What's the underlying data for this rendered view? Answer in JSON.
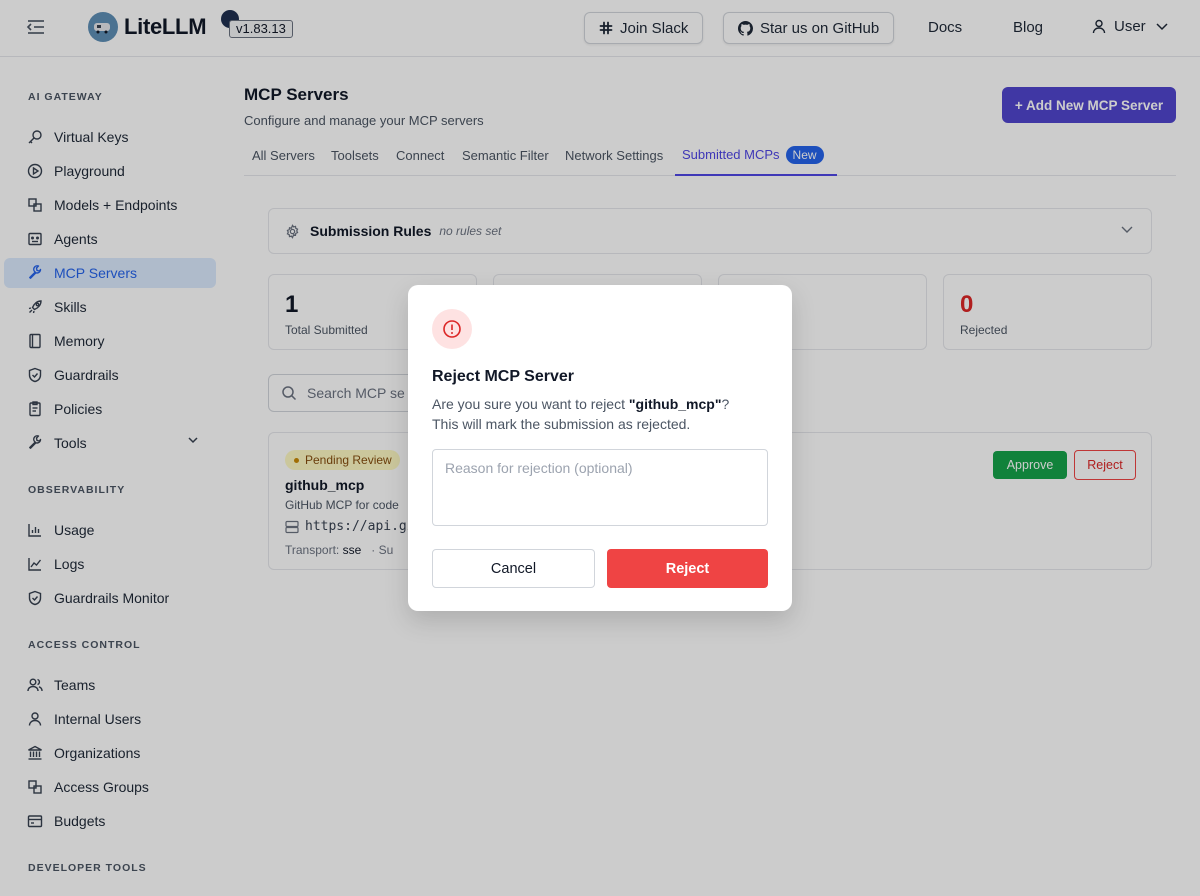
{
  "header": {
    "logo_text": "LiteLLM",
    "version": "v1.83.13",
    "join_slack": "Join Slack",
    "github": "Star us on GitHub",
    "docs": "Docs",
    "blog": "Blog",
    "user": "User"
  },
  "sidebar": {
    "sections": [
      {
        "title": "AI GATEWAY",
        "items": [
          {
            "label": "Virtual Keys",
            "icon": "key-icon"
          },
          {
            "label": "Playground",
            "icon": "play-icon"
          },
          {
            "label": "Models + Endpoints",
            "icon": "blocks-icon"
          },
          {
            "label": "Agents",
            "icon": "robot-icon"
          },
          {
            "label": "MCP Servers",
            "icon": "wrench-icon",
            "active": true
          },
          {
            "label": "Skills",
            "icon": "rocket-icon"
          },
          {
            "label": "Memory",
            "icon": "book-icon"
          },
          {
            "label": "Guardrails",
            "icon": "shield-icon"
          },
          {
            "label": "Policies",
            "icon": "clipboard-icon"
          },
          {
            "label": "Tools",
            "icon": "tool-icon"
          }
        ]
      },
      {
        "title": "OBSERVABILITY",
        "items": [
          {
            "label": "Usage",
            "icon": "bar-chart-icon"
          },
          {
            "label": "Logs",
            "icon": "line-chart-icon"
          },
          {
            "label": "Guardrails Monitor",
            "icon": "shield-icon"
          }
        ]
      },
      {
        "title": "ACCESS CONTROL",
        "items": [
          {
            "label": "Teams",
            "icon": "team-icon"
          },
          {
            "label": "Internal Users",
            "icon": "user-icon"
          },
          {
            "label": "Organizations",
            "icon": "bank-icon"
          },
          {
            "label": "Access Groups",
            "icon": "blocks-icon"
          },
          {
            "label": "Budgets",
            "icon": "wallet-icon"
          }
        ]
      },
      {
        "title": "DEVELOPER TOOLS",
        "items": []
      }
    ]
  },
  "main": {
    "title": "MCP Servers",
    "subtitle": "Configure and manage your MCP servers",
    "add_button": "+ Add New MCP Server",
    "tabs": [
      "All Servers",
      "Toolsets",
      "Connect",
      "Semantic Filter",
      "Network Settings",
      "Submitted MCPs"
    ],
    "active_tab_badge": "New",
    "rules": {
      "title": "Submission Rules",
      "note": "no rules set"
    },
    "stats": [
      {
        "value": "1",
        "label": "Total Submitted"
      },
      {
        "value": "",
        "label": ""
      },
      {
        "value": "",
        "label": ""
      },
      {
        "value": "0",
        "label": "Rejected"
      }
    ],
    "search_placeholder": "Search MCP se",
    "submission": {
      "status": "Pending Review",
      "name": "github_mcp",
      "description": "GitHub MCP for code",
      "url": "https://api.gi",
      "transport_label": "Transport:",
      "transport_value": "sse",
      "meta_extra": "·  Su",
      "approve": "Approve",
      "reject": "Reject"
    }
  },
  "modal": {
    "title": "Reject MCP Server",
    "text_prefix": "Are you sure you want to reject ",
    "server_name": "\"github_mcp\"",
    "text_suffix": "?",
    "text_line2": "This will mark the submission as rejected.",
    "reason_placeholder": "Reason for rejection (optional)",
    "cancel": "Cancel",
    "reject": "Reject"
  },
  "colors": {
    "primary": "#5145cd",
    "active_nav_bg": "#dbeafe",
    "danger": "#ef4444",
    "success": "#16a34a"
  }
}
